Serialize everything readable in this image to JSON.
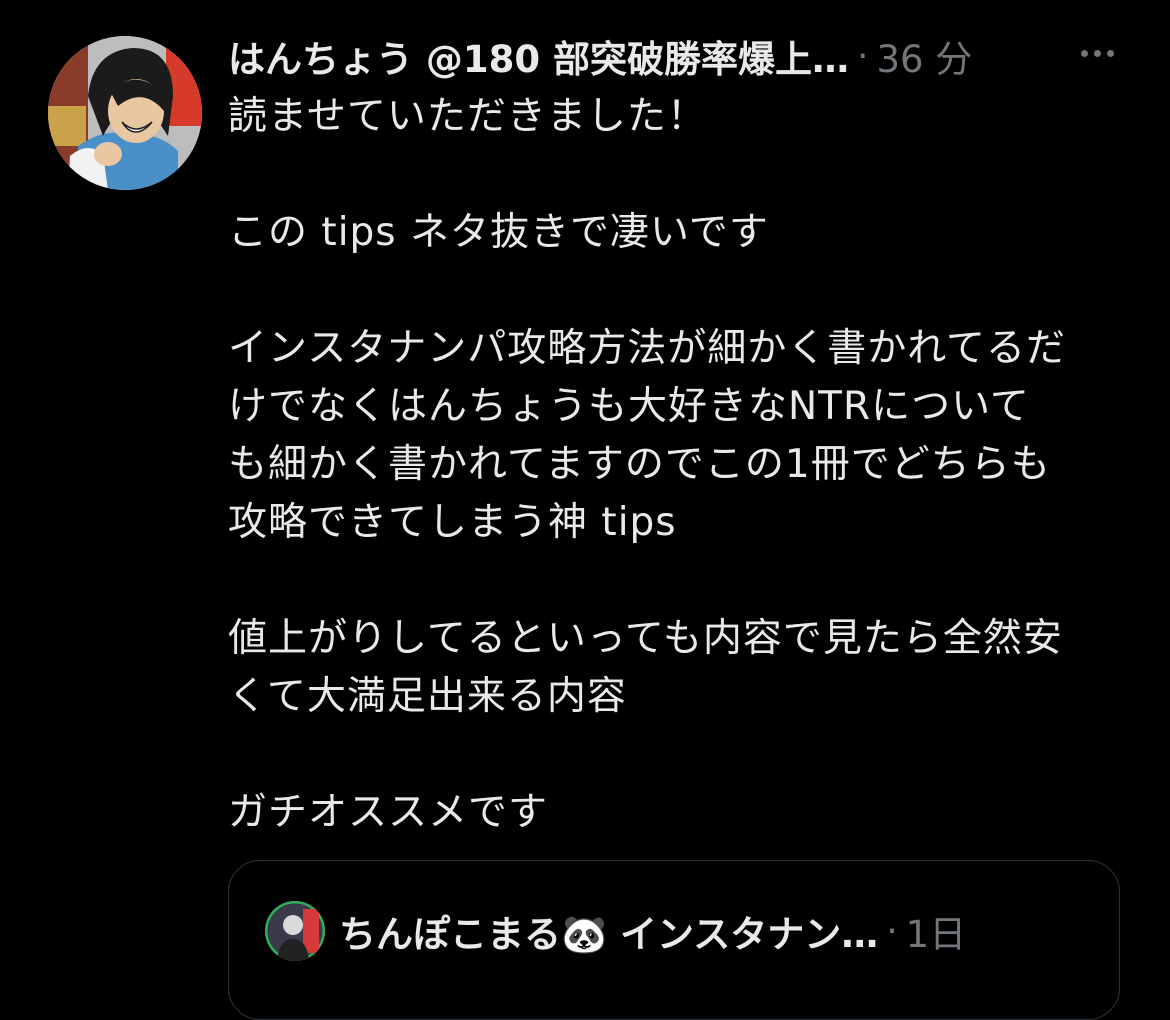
{
  "tweet": {
    "display_name": "はんちょう @180 部突破勝率爆上…",
    "separator": "·",
    "timestamp": "36 分",
    "paragraphs": [
      "読ませていただきました！",
      "この tips ネタ抜きで凄いです",
      "インスタナンパ攻略方法が細かく書かれてるだ\nけでなくはんちょうも大好きなNTRについて\nも細かく書かれてますのでこの1冊でどちらも\n攻略できてしまう神 tips",
      "値上がりしてるといっても内容で見たら全然安\nくて大満足出来る内容",
      "ガチオススメです"
    ]
  },
  "quoted_tweet": {
    "display_name": "ちんぽこまる🐼 インスタナン…",
    "separator": "·",
    "timestamp": "1日"
  },
  "icons": {
    "avatar": "user-avatar-illustration",
    "more": "more-horizontal-icon"
  },
  "colors": {
    "background": "#000000",
    "primary_text": "#e7e9ea",
    "secondary_text": "#71767b",
    "border": "#2f3336"
  }
}
